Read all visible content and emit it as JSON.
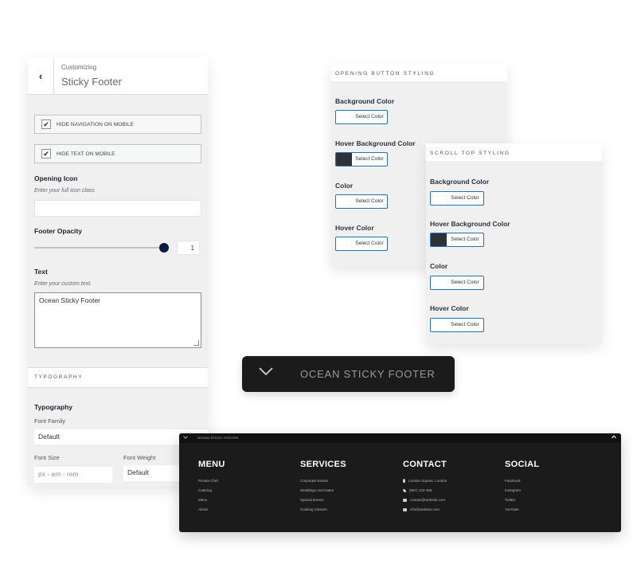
{
  "customizer": {
    "crumb": "Customizing",
    "title": "Sticky Footer",
    "hide_nav": {
      "label": "HIDE NAVIGATION ON MOBILE",
      "checked": true
    },
    "hide_text": {
      "label": "HIDE TEXT ON MOBILE",
      "checked": true
    },
    "opening_icon": {
      "label": "Opening Icon",
      "description": "Enter your full icon class",
      "value": ""
    },
    "footer_opacity": {
      "label": "Footer Opacity",
      "value": "1",
      "slider_fraction": 1.0
    },
    "text": {
      "label": "Text",
      "description": "Enter your custom text.",
      "value": "Ocean Sticky Footer"
    },
    "typography_section": "TYPOGRAPHY",
    "typography": {
      "label": "Typography",
      "font_family_label": "Font Family",
      "font_family_value": "Default",
      "font_size_label": "Font Size",
      "font_size_placeholder": "px - em - rem",
      "font_weight_label": "Font Weight",
      "font_weight_value": "Default"
    }
  },
  "opening_button_styling": {
    "title": "OPENING BUTTON STYLING",
    "items": [
      {
        "label": "Background Color",
        "button": "Select Color",
        "swatch": "#ffffff"
      },
      {
        "label": "Hover Background Color",
        "button": "Select Color",
        "swatch": "#2c3338"
      },
      {
        "label": "Color",
        "button": "Select Color",
        "swatch": "#ffffff"
      },
      {
        "label": "Hover Color",
        "button": "Select Color",
        "swatch": "#ffffff"
      }
    ]
  },
  "scroll_top_styling": {
    "title": "SCROLL TOP STYLING",
    "items": [
      {
        "label": "Background Color",
        "button": "Select Color",
        "swatch": "#ffffff"
      },
      {
        "label": "Hover Background Color",
        "button": "Select Color",
        "swatch": "#2c3338"
      },
      {
        "label": "Color",
        "button": "Select Color",
        "swatch": "#ffffff"
      },
      {
        "label": "Hover Color",
        "button": "Select Color",
        "swatch": "#ffffff"
      }
    ]
  },
  "pill": {
    "text": "OCEAN STICKY FOOTER"
  },
  "footer_preview": {
    "bar_text": "OCEAN STICKY FOOTER",
    "columns": [
      {
        "title": "MENU",
        "links": [
          "Private Chef",
          "Catering",
          "Menu",
          "About"
        ]
      },
      {
        "title": "SERVICES",
        "links": [
          "Corporate Events",
          "Weddings And Dates",
          "Special Events",
          "Cooking Classes"
        ]
      },
      {
        "title": "CONTACT",
        "links": [
          "London Square, London",
          "(567) 123-456",
          "contact@website.com",
          "info@website.com"
        ]
      },
      {
        "title": "SOCIAL",
        "links": [
          "Facebook",
          "Instagram",
          "Twitter",
          "YouTube"
        ]
      }
    ]
  },
  "colors": {
    "accent": "#2271b1",
    "dark": "#1b1b1b",
    "panel": "#f0f0f1",
    "knob": "#0b1a47"
  }
}
